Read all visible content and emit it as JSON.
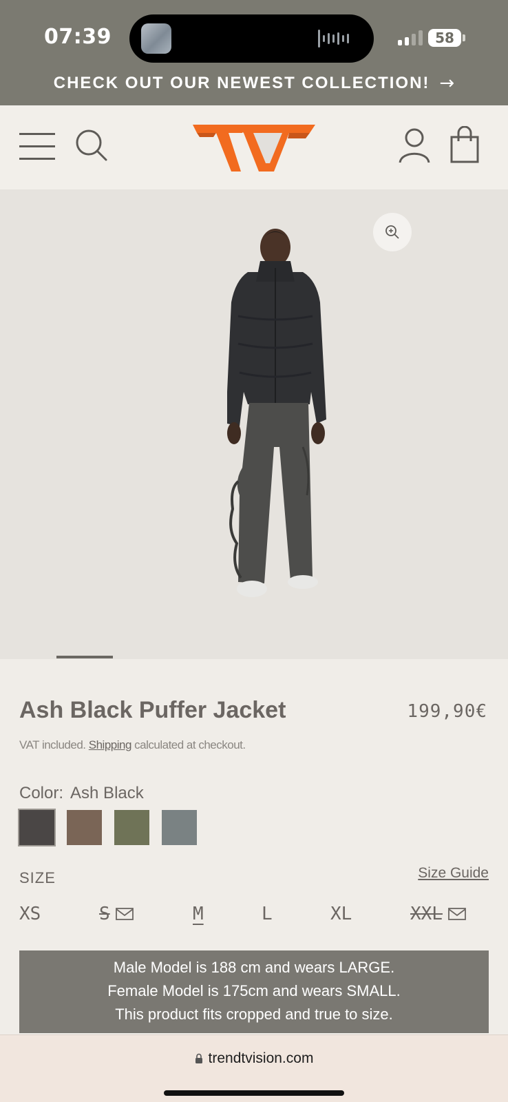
{
  "status_bar": {
    "time": "07:39",
    "battery": "58"
  },
  "announcement": {
    "text": "CHECK OUT OUR NEWEST COLLECTION!",
    "arrow": "→"
  },
  "brand": {
    "accent": "#f26b1f"
  },
  "product": {
    "title": "Ash Black Puffer Jacket",
    "price": "199,90€",
    "vat_prefix": "VAT included.",
    "shipping_link": "Shipping",
    "vat_suffix": "calculated at checkout.",
    "color_label": "Color:",
    "color_value": "Ash Black",
    "swatches": [
      {
        "name": "Ash Black",
        "hex": "#4a4645",
        "selected": true
      },
      {
        "name": "Brown",
        "hex": "#7a6556",
        "selected": false
      },
      {
        "name": "Olive",
        "hex": "#6f7357",
        "selected": false
      },
      {
        "name": "Grey Blue",
        "hex": "#7a8283",
        "selected": false
      }
    ],
    "size_label": "SIZE",
    "size_guide": "Size Guide",
    "sizes": [
      {
        "label": "XS",
        "available": true,
        "selected": false
      },
      {
        "label": "S",
        "available": false,
        "selected": false
      },
      {
        "label": "M",
        "available": true,
        "selected": true
      },
      {
        "label": "L",
        "available": true,
        "selected": false
      },
      {
        "label": "XL",
        "available": true,
        "selected": false
      },
      {
        "label": "XXL",
        "available": false,
        "selected": false
      }
    ],
    "fit_notice": [
      "Male Model is 188 cm and wears LARGE.",
      "Female Model is 175cm and wears SMALL.",
      "This product fits cropped and true to size."
    ]
  },
  "browser": {
    "url": "trendtvision.com"
  }
}
